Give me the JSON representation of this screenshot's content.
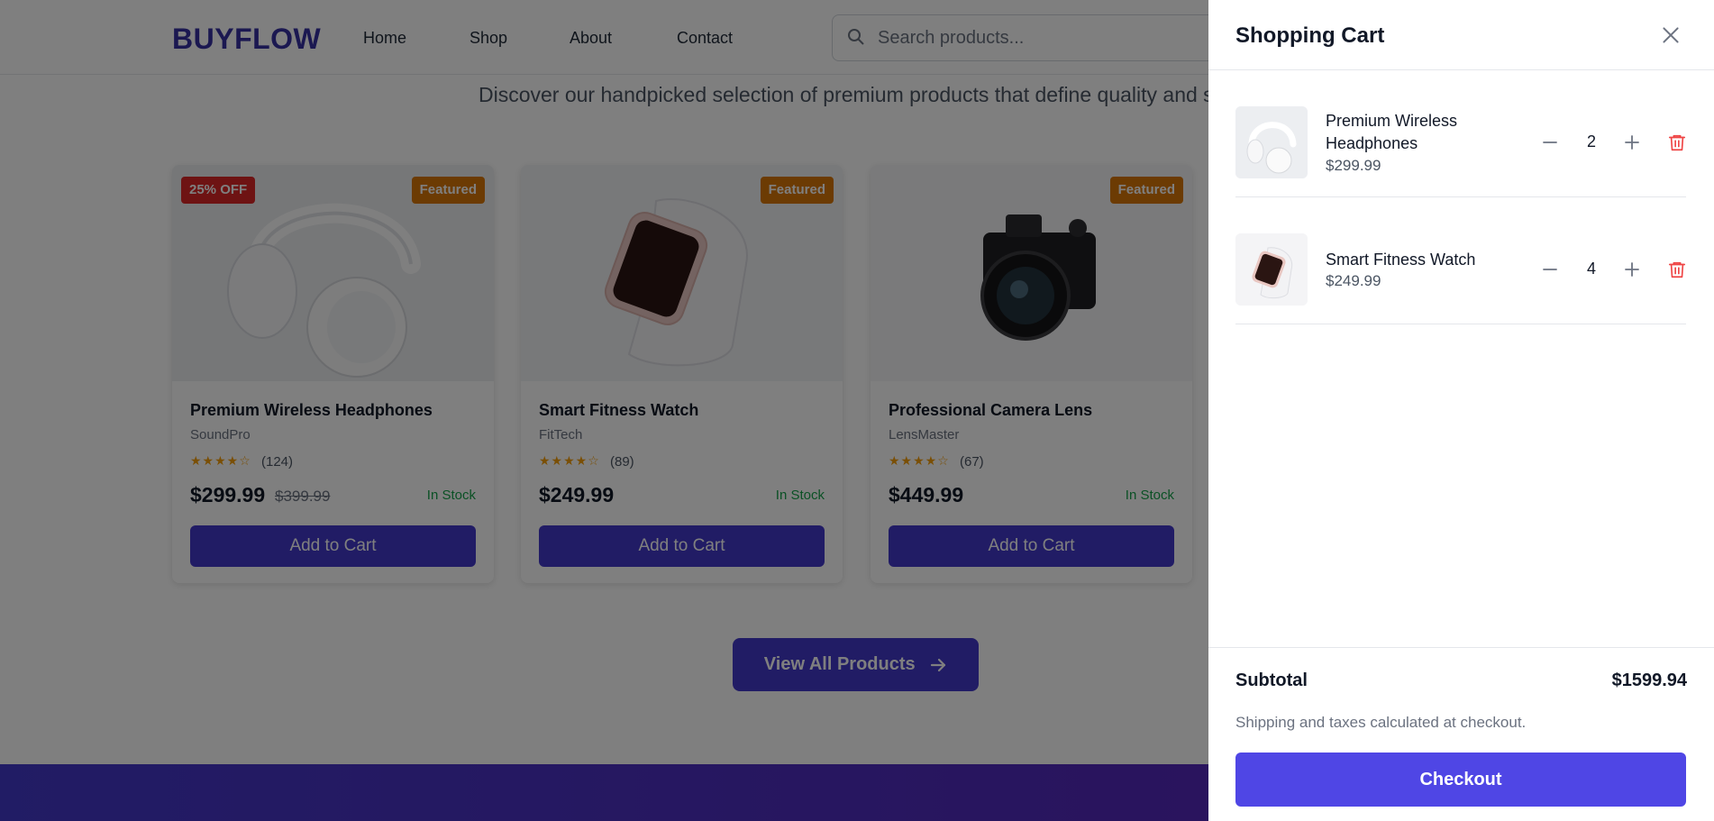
{
  "header": {
    "logo": "BUYFLOW",
    "nav": [
      "Home",
      "Shop",
      "About",
      "Contact"
    ],
    "search_placeholder": "Search products..."
  },
  "main": {
    "tagline": "Discover our handpicked selection of premium products that define quality and st",
    "products": [
      {
        "title": "Premium Wireless Headphones",
        "brand": "SoundPro",
        "stars": "★★★★☆",
        "rating": 4,
        "reviews": "(124)",
        "price": "$299.99",
        "old_price": "$399.99",
        "stock": "In Stock",
        "badge_discount": "25% OFF",
        "badge": "Featured",
        "button": "Add to Cart",
        "image_icon": "headphones-image"
      },
      {
        "title": "Smart Fitness Watch",
        "brand": "FitTech",
        "stars": "★★★★☆",
        "rating": 4,
        "reviews": "(89)",
        "price": "$249.99",
        "stock": "In Stock",
        "badge": "Featured",
        "button": "Add to Cart",
        "image_icon": "watch-image"
      },
      {
        "title": "Professional Camera Lens",
        "brand": "LensMaster",
        "stars": "★★★★☆",
        "rating": 4,
        "reviews": "(67)",
        "price": "$449.99",
        "stock": "In Stock",
        "badge": "Featured",
        "button": "Add to Cart",
        "image_icon": "camera-image"
      }
    ],
    "view_all": "View All Products"
  },
  "cart": {
    "title": "Shopping Cart",
    "items": [
      {
        "name": "Premium Wireless Headphones",
        "price": "$299.99",
        "qty": "2"
      },
      {
        "name": "Smart Fitness Watch",
        "price": "$249.99",
        "qty": "4"
      }
    ],
    "subtotal_label": "Subtotal",
    "subtotal_value": "$1599.94",
    "shipping_note": "Shipping and taxes calculated at checkout.",
    "checkout": "Checkout"
  },
  "colors": {
    "primary": "#4338ca",
    "checkout": "#4f46e5",
    "discount": "#dc2626",
    "featured": "#d97706",
    "in_stock": "#16a34a",
    "stars": "#f59e0b",
    "trash": "#ef4444"
  }
}
